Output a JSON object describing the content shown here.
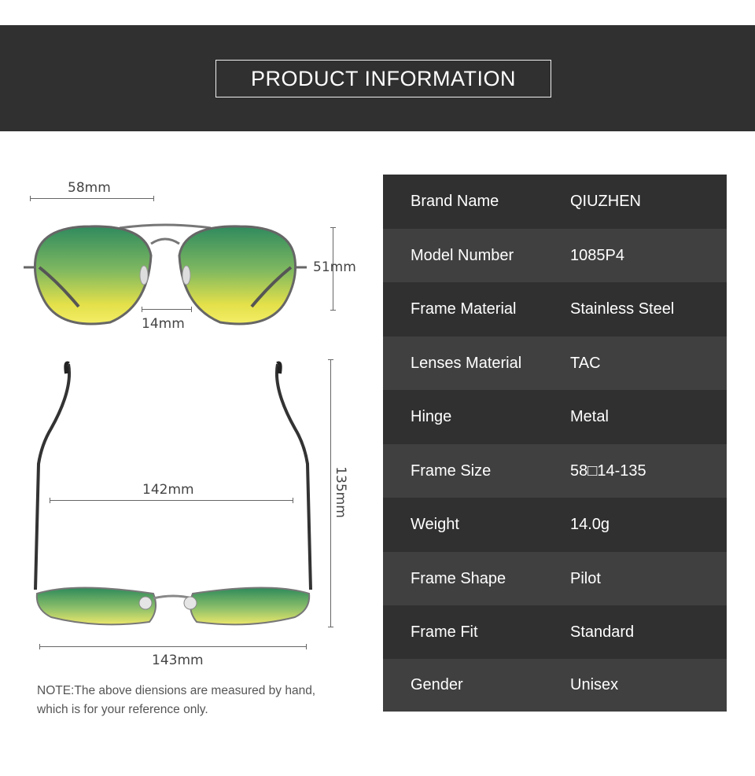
{
  "header": {
    "title": "PRODUCT INFORMATION"
  },
  "dimensions": {
    "lens_width": "58mm",
    "lens_height": "51mm",
    "bridge": "14mm",
    "temple_span": "142mm",
    "temple_length": "135mm",
    "total_width": "143mm"
  },
  "note": {
    "line1": "NOTE:The above diensions are measured by hand,",
    "line2": "which is for your reference only."
  },
  "specs": [
    {
      "key": "Brand Name",
      "value": "QIUZHEN"
    },
    {
      "key": "Model Number",
      "value": "1085P4"
    },
    {
      "key": "Frame Material",
      "value": "Stainless Steel"
    },
    {
      "key": "Lenses Material",
      "value": "TAC"
    },
    {
      "key": "Hinge",
      "value": "Metal"
    },
    {
      "key": "Frame Size",
      "value": "58□14-135"
    },
    {
      "key": "Weight",
      "value": "14.0g"
    },
    {
      "key": "Frame Shape",
      "value": "Pilot"
    },
    {
      "key": "Frame Fit",
      "value": "Standard"
    },
    {
      "key": "Gender",
      "value": "Unisex"
    }
  ],
  "colors": {
    "band": "#303030",
    "row_dark": "#303030",
    "row_light": "#404040",
    "lens_top": "#3f9b6a",
    "lens_bottom": "#e8e54a"
  }
}
